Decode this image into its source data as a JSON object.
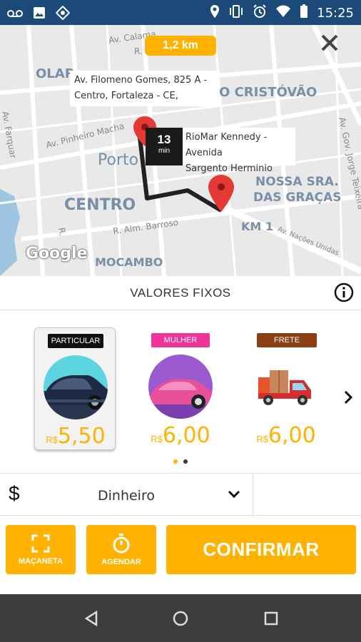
{
  "status_bar": {
    "time": "15:25",
    "left_icons": [
      "voicemail-icon",
      "image-icon",
      "location-target-icon"
    ],
    "right_icons": [
      "location-pin-icon",
      "vibrate-icon",
      "alarm-icon",
      "wifi-icon",
      "battery-icon"
    ]
  },
  "map": {
    "distance": "1,2 km",
    "origin_address": [
      "Av. Filomeno Gomes, 825 A -",
      "Centro, Fortaleza - CE,"
    ],
    "destination_address": [
      "RioMar Kennedy - Avenida",
      "Sargento Herminio"
    ],
    "eta_value": "13",
    "eta_unit": "min",
    "labels": {
      "olar": "OLAR",
      "sao_cristovao": "O CRISTÓVÃO",
      "porto": "Porto",
      "centro": "CENTRO",
      "nossa_sra_1": "NOSSA SRA.",
      "nossa_sra_2": "DAS GRAÇAS",
      "km1": "KM 1",
      "mocambo": "MOCAMBO"
    },
    "streets": {
      "calama": "Av. Calama",
      "r": "R.",
      "farquar": "Av. Farquar",
      "pinheiro_machado": "Av. Pinheiro Macha",
      "alm_barroso": "R. Alm. Barroso",
      "nacoes_unidas": "Av. Nações Unidas",
      "gov_jorge_teixeira": "Av. Gov. Jorge Teixeira",
      "r_vertical": "R."
    },
    "google": "Google"
  },
  "fixed_values": {
    "title": "VALORES FIXOS"
  },
  "options": [
    {
      "tag": "PARTICULAR",
      "currency": "R$",
      "price": "5,50",
      "tag_color": "#111111",
      "selected": true
    },
    {
      "tag": "MULHER",
      "currency": "R$",
      "price": "6,00",
      "tag_color": "#f0339a",
      "selected": false
    },
    {
      "tag": "FRETE",
      "currency": "R$",
      "price": "6,00",
      "tag_color": "#8b3f12",
      "selected": false
    }
  ],
  "pagination": {
    "active_index": 0,
    "count": 2
  },
  "payment": {
    "symbol": "$",
    "method": "Dinheiro"
  },
  "actions": {
    "macaneta": "MAÇANETA",
    "agendar": "AGENDAR",
    "confirm": "CONFIRMAR"
  },
  "colors": {
    "accent": "#ffb300",
    "status_bar": "#1c4a78",
    "nav_bar": "#3a3c3e",
    "pin": "#e53935"
  }
}
